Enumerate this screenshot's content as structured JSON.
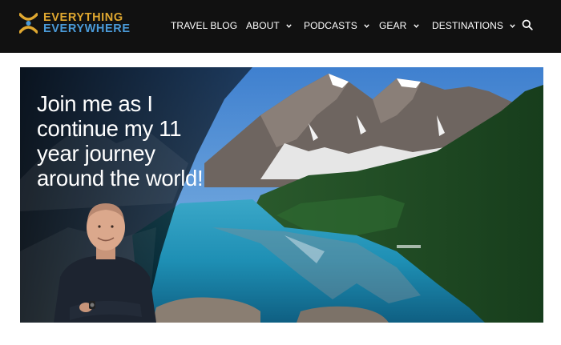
{
  "logo": {
    "line1": "EVERYTHING",
    "line2": "EVERYWHERE",
    "colors": {
      "gold": "#e0a830",
      "blue": "#4a9ad8"
    }
  },
  "nav": {
    "items": [
      {
        "label": "TRAVEL BLOG",
        "has_dropdown": false
      },
      {
        "label": "ABOUT",
        "has_dropdown": true
      },
      {
        "label": "PODCASTS",
        "has_dropdown": true
      },
      {
        "label": "GEAR",
        "has_dropdown": true
      },
      {
        "label": "DESTINATIONS",
        "has_dropdown": true
      }
    ],
    "search_icon": "search-icon",
    "dropdown_icon": "chevron-down-icon"
  },
  "hero": {
    "headline_lines": [
      "Join me as I",
      "continue my 11",
      "year journey",
      "around the world!"
    ],
    "image": "mountain-lake-landscape"
  },
  "colors": {
    "navbar_bg": "#111111",
    "nav_text": "#ffffff",
    "page_bg": "#ffffff"
  }
}
